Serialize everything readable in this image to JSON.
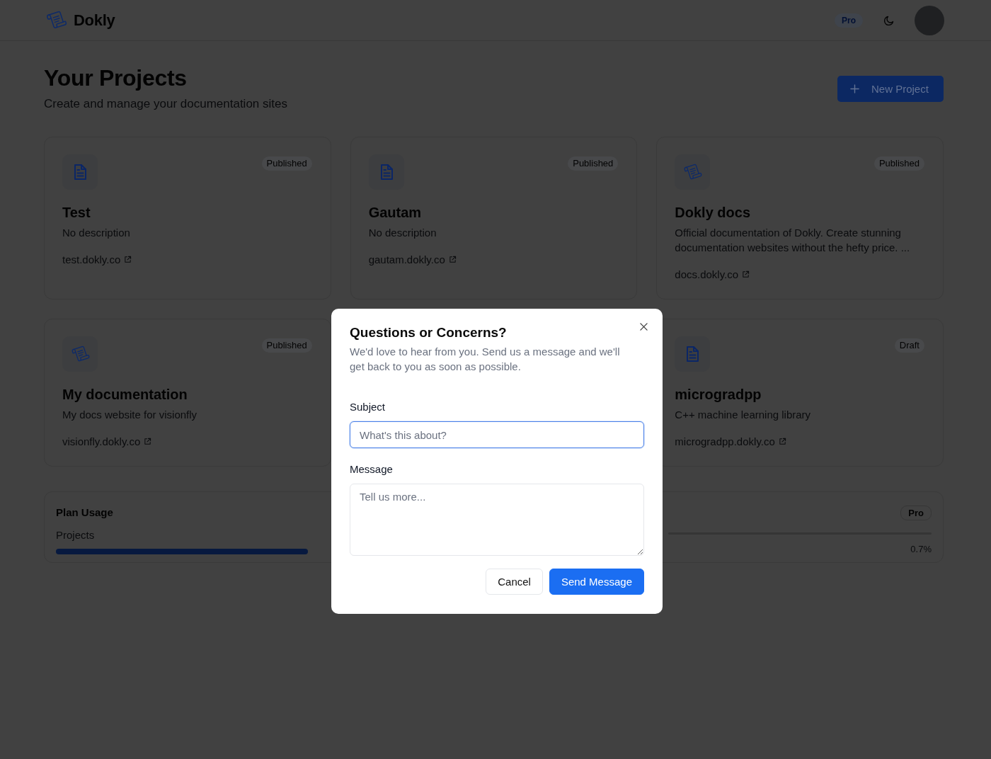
{
  "header": {
    "brand": "Dokly",
    "plan_badge": "Pro"
  },
  "page": {
    "title": "Your Projects",
    "subtitle": "Create and manage your documentation sites",
    "new_project_button": "New Project"
  },
  "projects": [
    {
      "kind": "document",
      "status": "Published",
      "name": "Test",
      "description": "No description",
      "url": "test.dokly.co"
    },
    {
      "kind": "document",
      "status": "Published",
      "name": "Gautam",
      "description": "No description",
      "url": "gautam.dokly.co"
    },
    {
      "kind": "scroll",
      "status": "Published",
      "name": "Dokly docs",
      "description": "Official documentation of Dokly. Create stunning documentation websites without the hefty price. ...",
      "url": "docs.dokly.co"
    },
    {
      "kind": "scroll",
      "status": "Published",
      "name": "My documentation",
      "description": "My docs website for visionfly",
      "url": "visionfly.dokly.co"
    },
    {
      "kind": "document",
      "status": "Draft",
      "name": "microgradpp",
      "description": "C++ machine learning library",
      "url": "microgradpp.dokly.co"
    }
  ],
  "plan_usage": {
    "title": "Plan Usage",
    "badge": "Pro",
    "metrics": [
      {
        "label": "Projects",
        "level": 1
      },
      {
        "reading": "0.7%"
      }
    ]
  },
  "contact_dialog": {
    "title": "Questions or Concerns?",
    "description": "We'd love to hear from you. Send us a message and we'll get back to you as soon as possible.",
    "fields": [
      {
        "kind": "input",
        "label": "Subject",
        "placeholder": "What's this about?",
        "focused": true
      },
      {
        "kind": "textarea",
        "label": "Message",
        "placeholder": "Tell us more...",
        "focused": false
      }
    ],
    "buttons": [
      {
        "kind": "secondary",
        "label": "Cancel"
      },
      {
        "kind": "primary",
        "label": "Send Message"
      }
    ]
  }
}
